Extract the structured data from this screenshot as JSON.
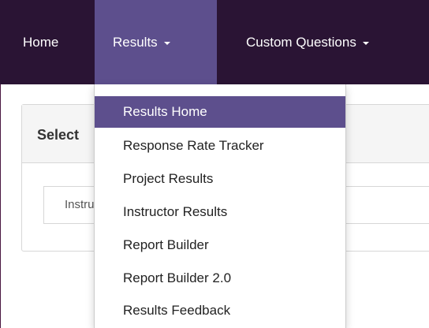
{
  "navbar": {
    "home_label": "Home",
    "results_label": "Results",
    "custom_label": "Custom Questions"
  },
  "panel": {
    "title": "Select",
    "tab_label": "Instructor"
  },
  "results_menu": {
    "items": [
      {
        "label": "Results Home"
      },
      {
        "label": "Response Rate Tracker"
      },
      {
        "label": "Project Results"
      },
      {
        "label": "Instructor Results"
      },
      {
        "label": "Report Builder"
      },
      {
        "label": "Report Builder 2.0"
      },
      {
        "label": "Results Feedback"
      }
    ]
  },
  "colors": {
    "navbar_bg": "#2a1434",
    "active_accent": "#5d4f8d"
  }
}
